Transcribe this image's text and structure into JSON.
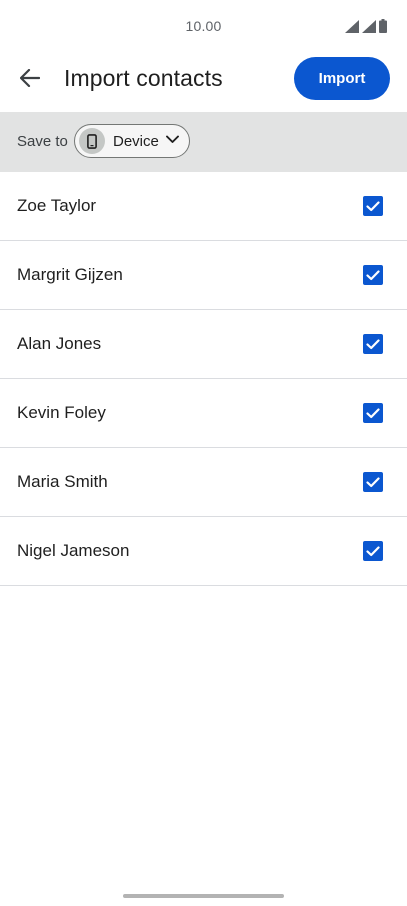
{
  "status_bar": {
    "time": "10.00",
    "icons": [
      "signal-icon",
      "signal-icon",
      "battery-icon"
    ]
  },
  "app_bar": {
    "back_icon": "arrow-back-icon",
    "title": "Import contacts",
    "import_label": "Import"
  },
  "save_to": {
    "label": "Save to",
    "chip_icon": "phone-icon",
    "chip_label": "Device",
    "chip_chevron_icon": "chevron-down-icon"
  },
  "contacts": [
    {
      "name": "Zoe Taylor",
      "checked": true
    },
    {
      "name": "Margrit Gijzen",
      "checked": true
    },
    {
      "name": "Alan Jones",
      "checked": true
    },
    {
      "name": "Kevin Foley",
      "checked": true
    },
    {
      "name": "Maria Smith",
      "checked": true
    },
    {
      "name": "Nigel Jameson",
      "checked": true
    }
  ],
  "colors": {
    "accent": "#0b57d0",
    "save_bar_bg": "#e2e3e3",
    "divider": "#dadce0"
  }
}
